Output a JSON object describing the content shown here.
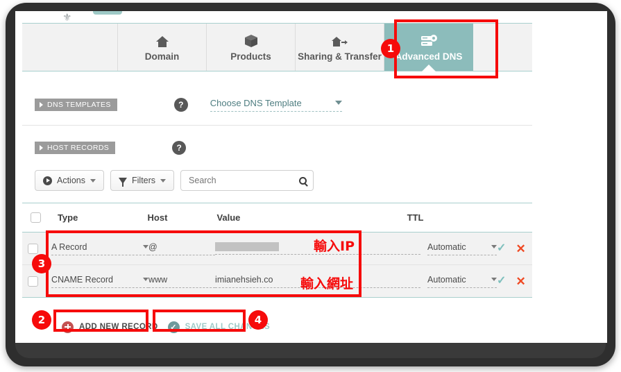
{
  "window": {
    "screen_label": "namecheap-advanced-dns-panel"
  },
  "tabs": [
    {
      "label": "Domain",
      "icon": "house-icon",
      "active": false
    },
    {
      "label": "Products",
      "icon": "box-icon",
      "active": false
    },
    {
      "label": "Sharing & Transfer",
      "icon": "house-arrow-icon",
      "active": false
    },
    {
      "label": "Advanced DNS",
      "icon": "server-gear-icon",
      "active": true
    }
  ],
  "sections": {
    "dns_templates": {
      "tag": "DNS TEMPLATES",
      "help": "?",
      "select_value": "Choose DNS Template"
    },
    "host_records": {
      "tag": "HOST RECORDS",
      "help": "?"
    }
  },
  "toolbar": {
    "actions_label": "Actions",
    "filters_label": "Filters",
    "search_placeholder": "Search",
    "search_value": ""
  },
  "table": {
    "headers": [
      "Type",
      "Host",
      "Value",
      "TTL"
    ],
    "rows": [
      {
        "type": "A Record",
        "host": "@",
        "value": "",
        "value_redacted": true,
        "ttl": "Automatic",
        "confirm_icon": "check-icon",
        "delete_icon": "x-icon"
      },
      {
        "type": "CNAME Record",
        "host": "www",
        "value": "imianehsieh.co",
        "value_redacted": false,
        "ttl": "Automatic",
        "confirm_icon": "check-icon",
        "delete_icon": "x-icon"
      }
    ]
  },
  "footer": {
    "add_new_record": "ADD NEW RECORD",
    "save_all_changes": "SAVE ALL CHANGES"
  },
  "annotations": {
    "badges": [
      "1",
      "2",
      "3",
      "4"
    ],
    "callout_ip": "輸入IP",
    "callout_url": "輸入網址",
    "accent_color": "#f60b0b"
  },
  "colors": {
    "tab_active_bg": "#8cbcbb",
    "teal_rule": "#a8cfcd",
    "row_bg": "#f2f2f2",
    "section_tag_bg": "#9b9b9b",
    "delete_x": "#ef4923",
    "save_disabled": "#9fc9c7"
  }
}
